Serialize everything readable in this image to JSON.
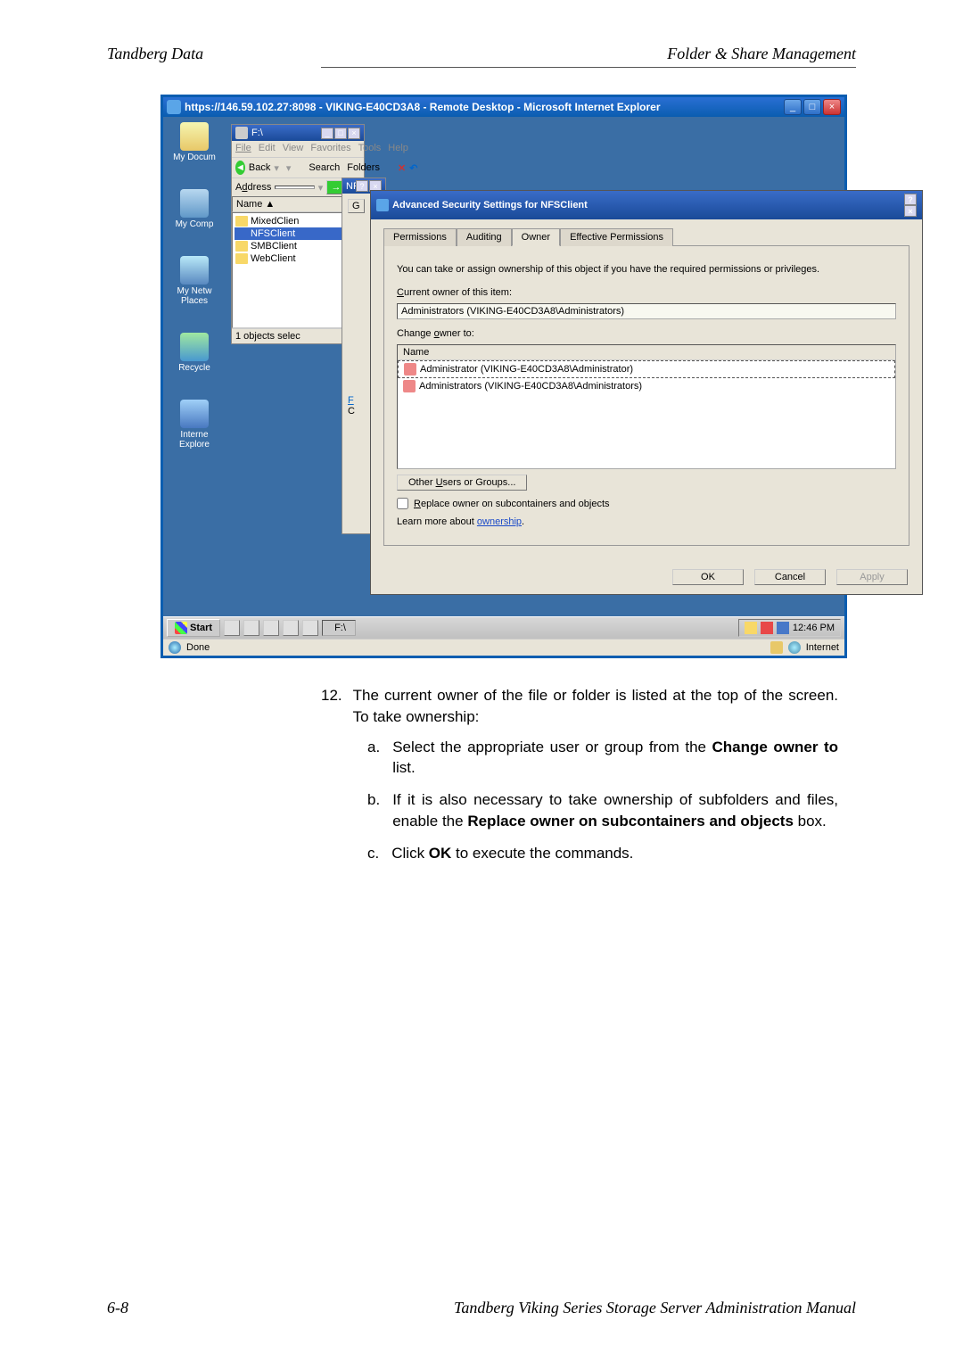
{
  "header": {
    "left": "Tandberg Data",
    "right": "Folder & Share Management"
  },
  "ie": {
    "title": "https://146.59.102.27:8098 - VIKING-E40CD3A8 - Remote Desktop - Microsoft Internet Explorer",
    "status": "Done",
    "zone": "Internet"
  },
  "desktop": {
    "icons": [
      "My Docum",
      "My Comp",
      "My Netw Places",
      "Recycle",
      "Interne Explore"
    ]
  },
  "explorer": {
    "title": "F:\\",
    "menu": [
      "File",
      "Edit",
      "View",
      "Favorites",
      "Tools",
      "Help"
    ],
    "back": "Back",
    "search": "Search",
    "folders": "Folders",
    "addr_label": "Address",
    "addr_value": "",
    "go": "Go",
    "header": "Name",
    "items": [
      "MixedClien",
      "NFSClient",
      "SMBClient",
      "WebClient"
    ],
    "status": "1 objects selec"
  },
  "props": {
    "title": "NFSClient Properties",
    "tab0": "G"
  },
  "adv": {
    "title": "Advanced Security Settings for NFSClient",
    "tabs": [
      "Permissions",
      "Auditing",
      "Owner",
      "Effective Permissions"
    ],
    "desc": "You can take or assign ownership of this object if you have the required permissions or privileges.",
    "current_label": "Current owner of this item:",
    "current_value": "Administrators (VIKING-E40CD3A8\\Administrators)",
    "change_label": "Change owner to:",
    "list_header": "Name",
    "owners": [
      "Administrator (VIKING-E40CD3A8\\Administrator)",
      "Administrators (VIKING-E40CD3A8\\Administrators)"
    ],
    "other": "Other Users or Groups...",
    "replace": "Replace owner on subcontainers and objects",
    "learn": "Learn more about ",
    "learn_link": "ownership",
    "ok": "OK",
    "cancel": "Cancel",
    "apply": "Apply"
  },
  "taskbar": {
    "start": "Start",
    "task": "F:\\",
    "time": "12:46 PM"
  },
  "body": {
    "step_num": "12.",
    "step_text": "The current owner of the file or folder is listed at the top of the screen. To take ownership:",
    "a_num": "a.",
    "a_pre": "Select the appropriate user or group from the ",
    "a_bold": "Change owner to",
    "a_post": " list.",
    "b_num": "b.",
    "b_pre": "If it is also necessary to take ownership of subfolders and files, enable the ",
    "b_bold": "Replace owner on subcontainers and objects",
    "b_post": " box.",
    "c_num": "c.",
    "c_pre": "Click ",
    "c_bold": "OK",
    "c_post": " to execute the commands."
  },
  "footer": {
    "page": "6-8",
    "title": "Tandberg Viking Series Storage Server Administration Manual"
  }
}
